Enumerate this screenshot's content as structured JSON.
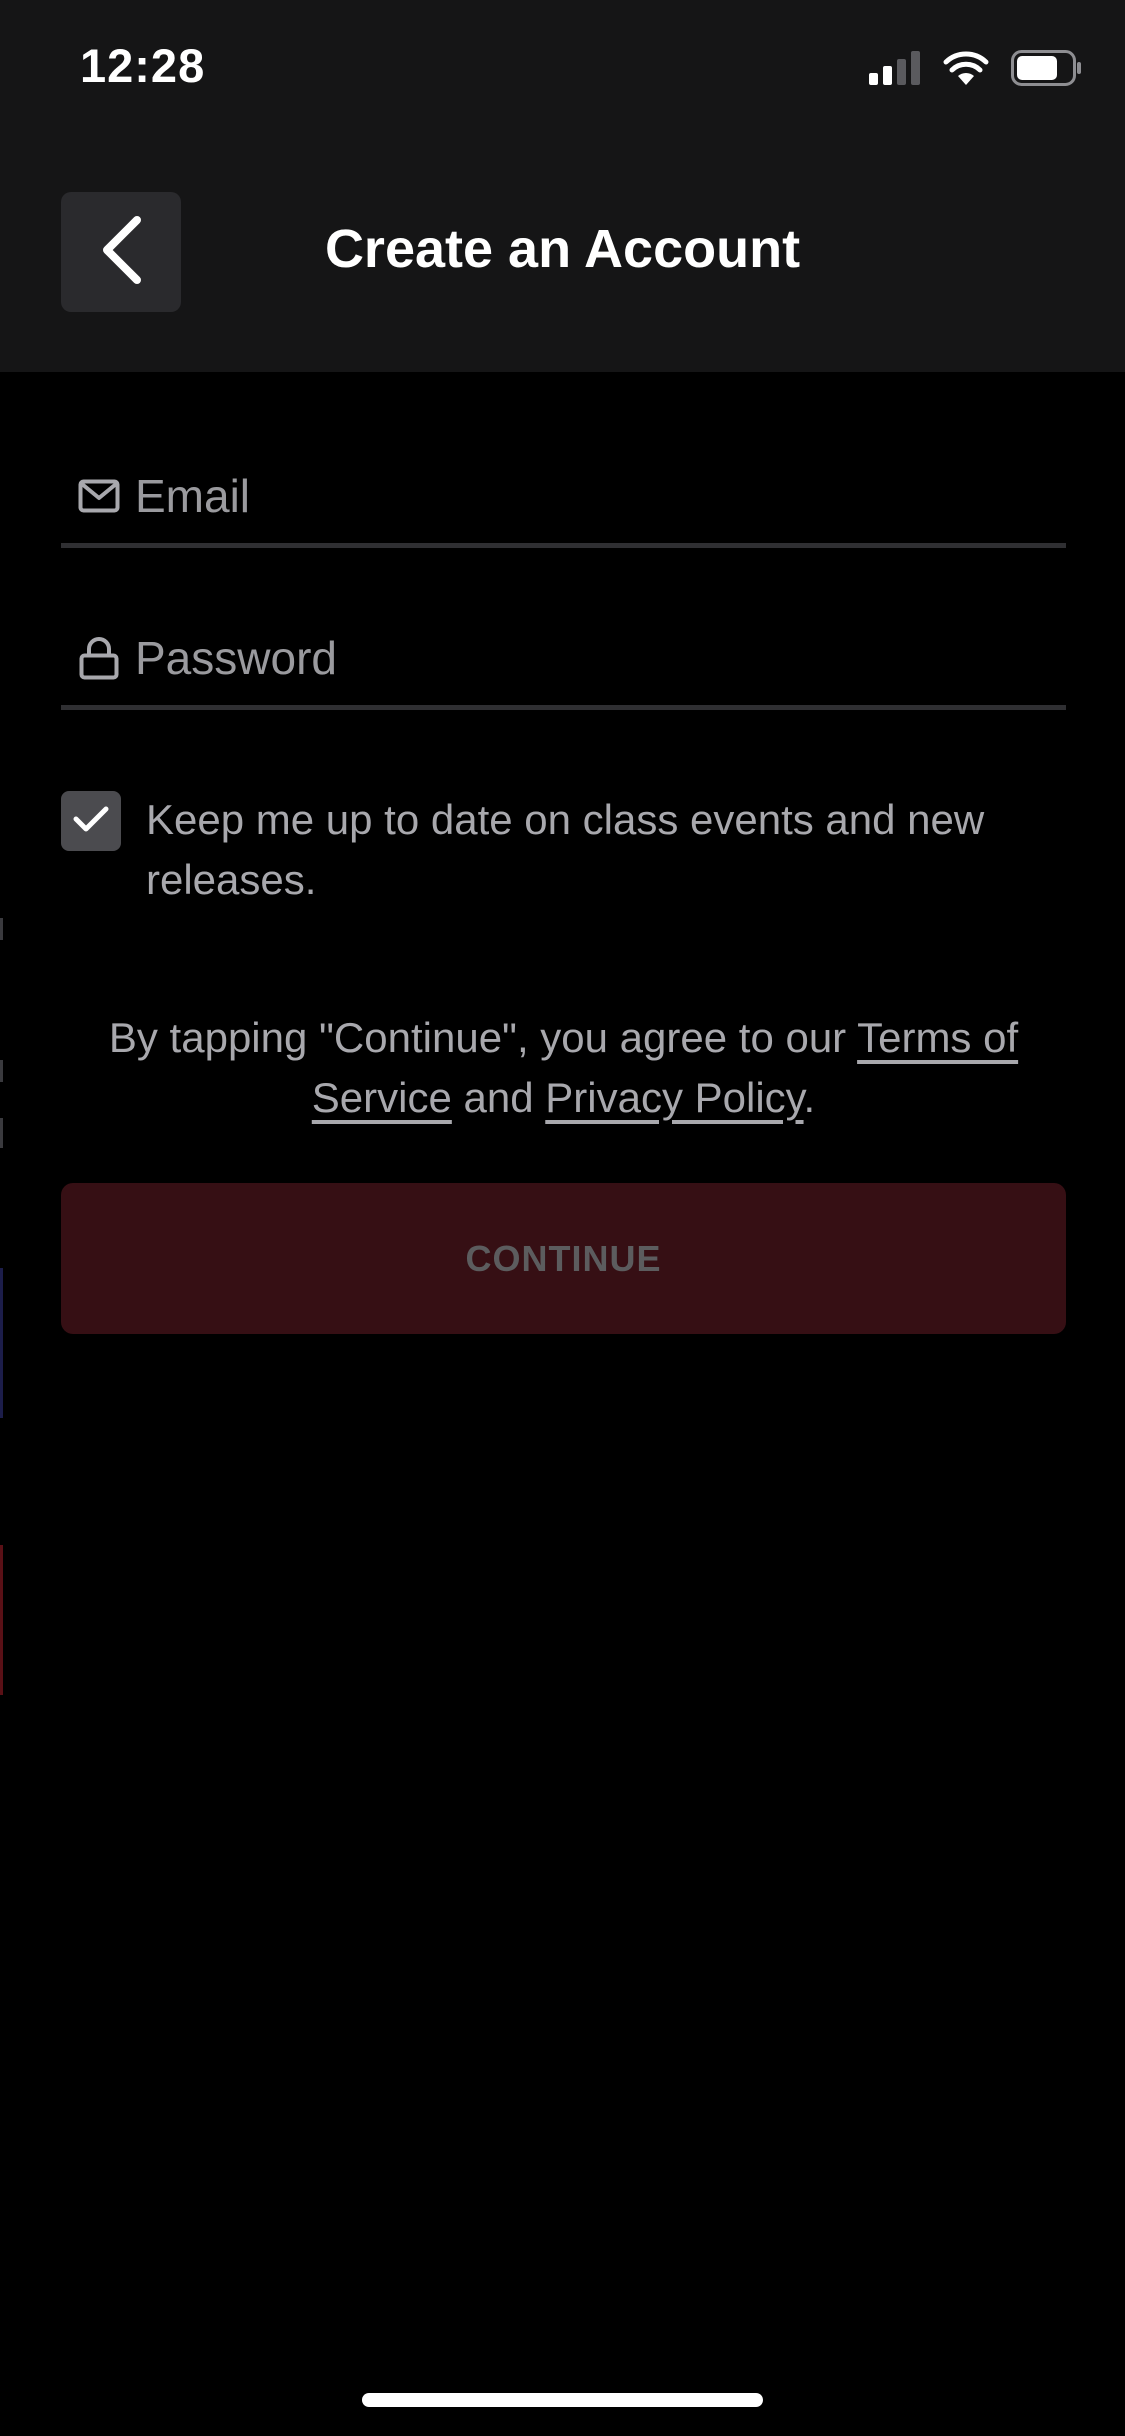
{
  "status_bar": {
    "time": "12:28",
    "icons": [
      "cellular-signal-icon",
      "wifi-icon",
      "battery-icon"
    ],
    "signal_bars_active": 2,
    "signal_bars_total": 4,
    "battery_level": 0.7
  },
  "header": {
    "title": "Create an Account",
    "back_icon": "chevron-left-icon"
  },
  "form": {
    "email": {
      "placeholder": "Email",
      "value": "",
      "icon": "mail-icon"
    },
    "password": {
      "placeholder": "Password",
      "value": "",
      "icon": "lock-icon"
    },
    "newsletter": {
      "checked": true,
      "label": "Keep me up to date on class events and new releases."
    }
  },
  "terms": {
    "prefix": "By tapping \"Continue\", you agree to our ",
    "terms_link": "Terms of Service",
    "middle": " and ",
    "privacy_link": "Privacy Policy",
    "suffix": "."
  },
  "continue_button": {
    "label": "CONTINUE",
    "enabled": false
  },
  "colors": {
    "background": "#000000",
    "header_bg": "#151516",
    "button_disabled_bg": "#360f14",
    "text_secondary": "#a8a8ad"
  }
}
